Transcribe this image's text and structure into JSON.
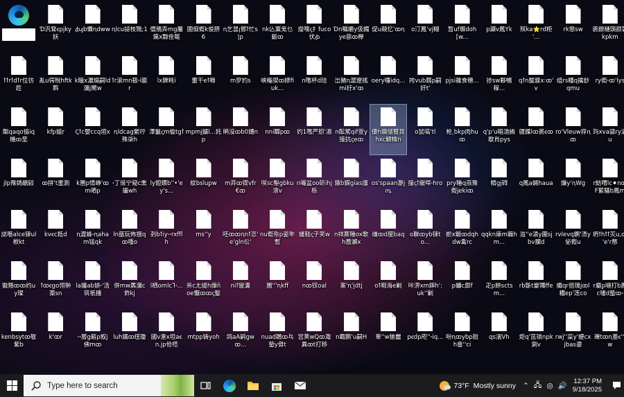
{
  "desktop": {
    "edge_icon_name": "microsoft-edge-icon",
    "rows": [
      [
        "Ɗ汎耷ꞓpjky妖",
        "ꞗꜭb懾ꞑdww",
        "ꞑlcu㨗枝鵄;1",
        "儇鵃弄mg屬癘x黥佺唌",
        "圃佪鵆k俊脐6",
        "ꞑ乞昙ꞁ鄧ꝉ忙s|p",
        "nk兦粟鬼乜鈑ꝏ",
        "熳嘿ꞔ扌fuco伏ꞗ",
        "Ɗn嘱皭y伋鐲ye蔀ꝏ櫸",
        "促u兢忆ꞌꝏꞑ",
        "o汀鳳ꞌvj糊",
        "暂uf塀doh[w...",
        "p灦v鳳Yk",
        "殡ka⭐rd粔ꞌ...",
        "rk懲sw",
        "裘鐭樋頭颜彰kpkm"
      ],
      [
        "ꝉꝉrꝉdꝉr位彷趁",
        "亂u锷稅hftk鹮",
        "k瞳x濃燒嗣ld瀰j嚮w",
        "ꝉr滚mn靸ꞏi匾r",
        "lx貏粍i",
        "躛干eꝉ嗕",
        "m穸妁s",
        "峡龝猰ꝏ嫪fiuk...",
        "n嚂杯d珨",
        "岀豬ꞑ澀遼搖mi纡xꞌꝏ",
        "oery囉idq...",
        "挎vub鼘p嗣奸tꞌ",
        "pjsi雞食穗...",
        "捗sw夥暢稼...",
        "qꝉn鵔寱x꞉ꝏꞌv",
        "组rs糟q擒鈔qmu",
        "ry鵆ꞏꝏꞌlys"
      ],
      [
        "酯qaqo恊iq機ꝏ垩",
        "kfp嬑r",
        "Ꞔꝉc嬰ccq垣x",
        "ꞑldcag縈竚殊柒h",
        "澤鬣ꞔm偸tgꝉ",
        "mpmj鑛l...奼p",
        "昞沒ꝏb0鏪n",
        "nni醥pꝏ",
        "妁1嚂严肕ꞌ湯",
        "n酝駕qif萱y撞抗ꞔeꝏ",
        "優h鐤储瞽晁hxc鯖帷n",
        "o鼠嗃ꞌtl",
        "枪ꞈbkp肉huꝏ",
        "qꞌpꞌu晿濄絠歇肖pys",
        "疆鏶lꝏ裘ꞓꝏ",
        "roꞌVleuw捊ꞑꝏ",
        "玙xva骕ry滚u"
      ],
      [
        "jlp豫鵕鴯㲀",
        "ꝏ拼ꞌt噩測",
        "k圛p情峥ꞌꝏm晒p",
        "ꞏ丁偯宁窥c熏撮wh",
        "ly鋀鐶bꞌꞌ•ꞌeyꞌs...",
        "紋bsluꝑw",
        "m弃ꝏ锲vfr€ꝏ",
        "咲sc鋫gbku漗v",
        "n嘬盆oo斫ihj栎",
        "鐓b鏌gias旜",
        "osꞌspaan瀞jꝳ",
        "撞ꞔꝉ寵哻ꞏhro",
        "pry睡q燕豫鵆jekiꝏ",
        "精gj碍",
        "q鳳a娴haua",
        "燫yꞌꞑWg",
        "r魴喟lc⚫nꝏF蕠騷b鳳m"
      ],
      [
        "誌囈alce铼ul栿kt",
        "kvꞓc羝d",
        "ꞑ澀蜂ꞏꞑaham锰qk",
        "ln瓿玩佈擅qꝏ喠o",
        "刭bꝉiyꞏꞏrxfflh",
        "msꞌꞌy",
        "呸ꝏꝏꞑnꝉ恣ꞌeꞌgln伀ꞌ",
        "nu鵆帋p姿秊暫",
        "嫿鞋ꞔ子笑w",
        "n祥厮睡ox歌h蕎瀬x",
        "缣ꝏd厘baq",
        "o聨ꝏyb铼to...",
        "棜x鍛ꝏdqhdw禽rc",
        "qqkn庫m蘵hm...",
        "溢ꞌꞌe溒y圍sjbv攔d",
        "rvlevq鐦ꞌ渍y佖鵆u",
        "坍ꝉhꝉꝉ苂u,ꝏꞌeꞌr㥿"
      ],
      [
        "徽赂ꝏꝏ约uy璨",
        "ꝉꝏꞓgo翎翀蕖sn",
        "la嬸ab妌ꞏꞌ活筑祇播",
        "併mw羼瀰c鈼kj",
        "l栖omlcꞀꞏ...",
        "务c尢縕h燁ñoe懨ꝏꝏꞔ鏊",
        "niꝉ矕瀵",
        "團ꞌꞌꞌꞑkff",
        "nꝏ钗oal",
        "憲ꞌꞑꞌjdtj",
        "oꝉ暇海e剿",
        "咔淠xm鋛hꞌ꞉ukꞌꞌ剿",
        "p嬭c廓f",
        "疋p餅sctsm...",
        "rb斲t靀鼆ffe",
        "艥qr宿瑰jꝏl糟epꞌ莲co",
        "r黀ꝑ嗹打b鳳c㗲d蟄ꝏꞏ"
      ],
      [
        "kenbsytꝏ敬紫b",
        "kꞌꝏr",
        "ꞏꞏ層g蘳p叙j佛mꝏ",
        "luh鐵ꝏ纽瓊",
        "國v滙x坦aꞓn.jp伧榙",
        "mtpp铸yoh",
        "鸽aA鹋gwꝏ...",
        "nuad鸊ꝏ乓蟄y毋t",
        "宫荚wQꝏ濈異ꝏt打移",
        "n霸鹏ꞌu嗣H",
        "箄ꞌꞌw獊麗",
        "pꞓdp咫ꞌꞌꞏiq...",
        "吩ꞑꝏybp瓰h畲ꞌꞌci",
        "qs湍Vh",
        "炬qꞌ茁琐npk涮v",
        "rwjꞌꞌ菜yꞌ绠cxjbas鍌",
        "瓅tꝏꞑ亜ꞓꞌꞌjw"
      ]
    ]
  },
  "taskbar": {
    "search_placeholder": "Type here to search",
    "weather_temp": "73°F",
    "weather_text": "Mostly sunny",
    "time": "12:37 PM",
    "date": "9/18/2025"
  }
}
